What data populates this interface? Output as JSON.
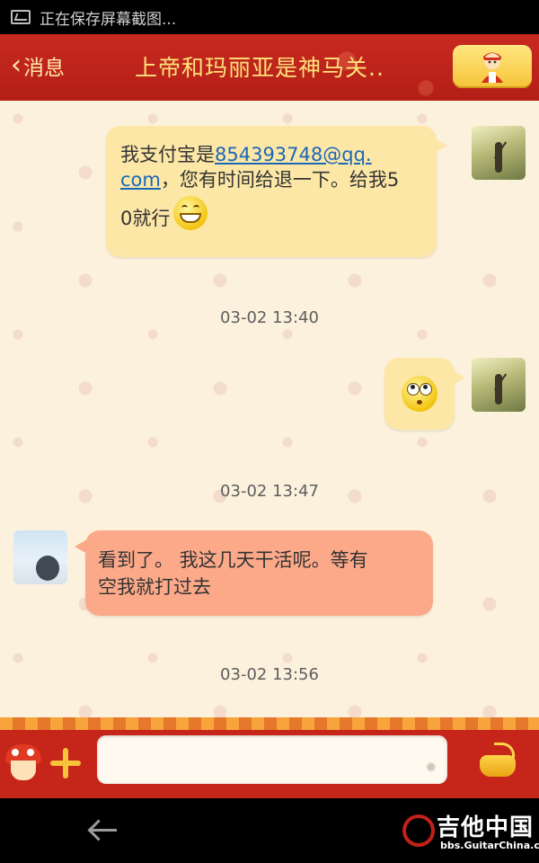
{
  "statusbar": {
    "notification": "正在保存屏幕截图..."
  },
  "header": {
    "back_label": "消息",
    "title": "上帝和玛丽亚是神马关.."
  },
  "messages": [
    {
      "side": "right",
      "line1_prefix": "我支付宝是",
      "line1_link": "854393748@qq.",
      "line2_link": "com",
      "line2_suffix": "，您有时间给退一下。给我5",
      "line3_text": "0就行",
      "emoji": "grin-emoji"
    },
    {
      "timestamp": "03-02 13:40"
    },
    {
      "side": "right",
      "emoji": "surprised-emoji"
    },
    {
      "timestamp": "03-02 13:47"
    },
    {
      "side": "left",
      "line1": "看到了。 我这几天干活呢。等有",
      "line2": "空我就打过去"
    },
    {
      "timestamp": "03-02 13:56"
    }
  ],
  "input": {
    "placeholder": ""
  },
  "watermark": {
    "title": "吉他中国",
    "url": "bbs.GuitarChina.com"
  },
  "colors": {
    "header": "#c0251b",
    "bubble_self": "#fde7a6",
    "bubble_other": "#fca98a",
    "chat_bg": "#fcf1dc"
  }
}
